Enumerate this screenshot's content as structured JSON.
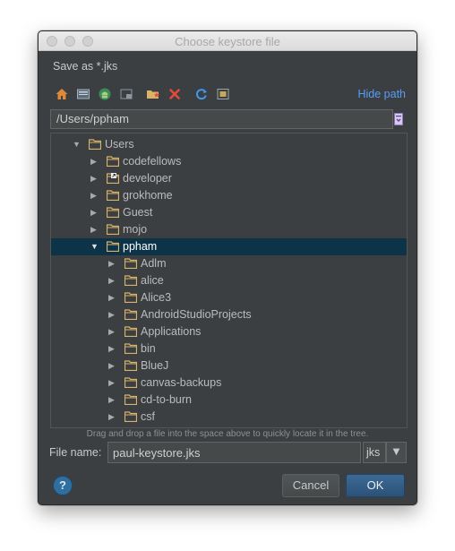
{
  "window": {
    "title": "Choose keystore file"
  },
  "subtitle": "Save as *.jks",
  "toolbar": {
    "icons": [
      "home-icon",
      "desktop-icon",
      "android-project-icon",
      "module-icon",
      "new-folder-icon",
      "delete-icon",
      "refresh-icon",
      "show-hidden-icon"
    ],
    "hide_path_label": "Hide path"
  },
  "path": {
    "value": "/Users/ppham"
  },
  "tree": {
    "root": {
      "label": "Users",
      "expanded": true
    },
    "items": [
      {
        "label": "codefellows"
      },
      {
        "label": "developer"
      },
      {
        "label": "grokhome"
      },
      {
        "label": "Guest"
      },
      {
        "label": "mojo"
      },
      {
        "label": "ppham",
        "selected": true,
        "expanded": true
      },
      {
        "label": "Adlm"
      },
      {
        "label": "alice"
      },
      {
        "label": "Alice3"
      },
      {
        "label": "AndroidStudioProjects"
      },
      {
        "label": "Applications"
      },
      {
        "label": "bin"
      },
      {
        "label": "BlueJ"
      },
      {
        "label": "canvas-backups"
      },
      {
        "label": "cd-to-burn"
      },
      {
        "label": "csf"
      }
    ]
  },
  "hint": "Drag and drop a file into the space above to quickly locate it in the tree.",
  "file_name": {
    "label": "File name:",
    "value": "paul-keystore.jks",
    "extension": "jks"
  },
  "buttons": {
    "help": "?",
    "cancel": "Cancel",
    "ok": "OK"
  },
  "colors": {
    "accent": "#589df6",
    "selection": "#0d3349",
    "folder": "#d9b368",
    "background": "#3c3f41"
  }
}
